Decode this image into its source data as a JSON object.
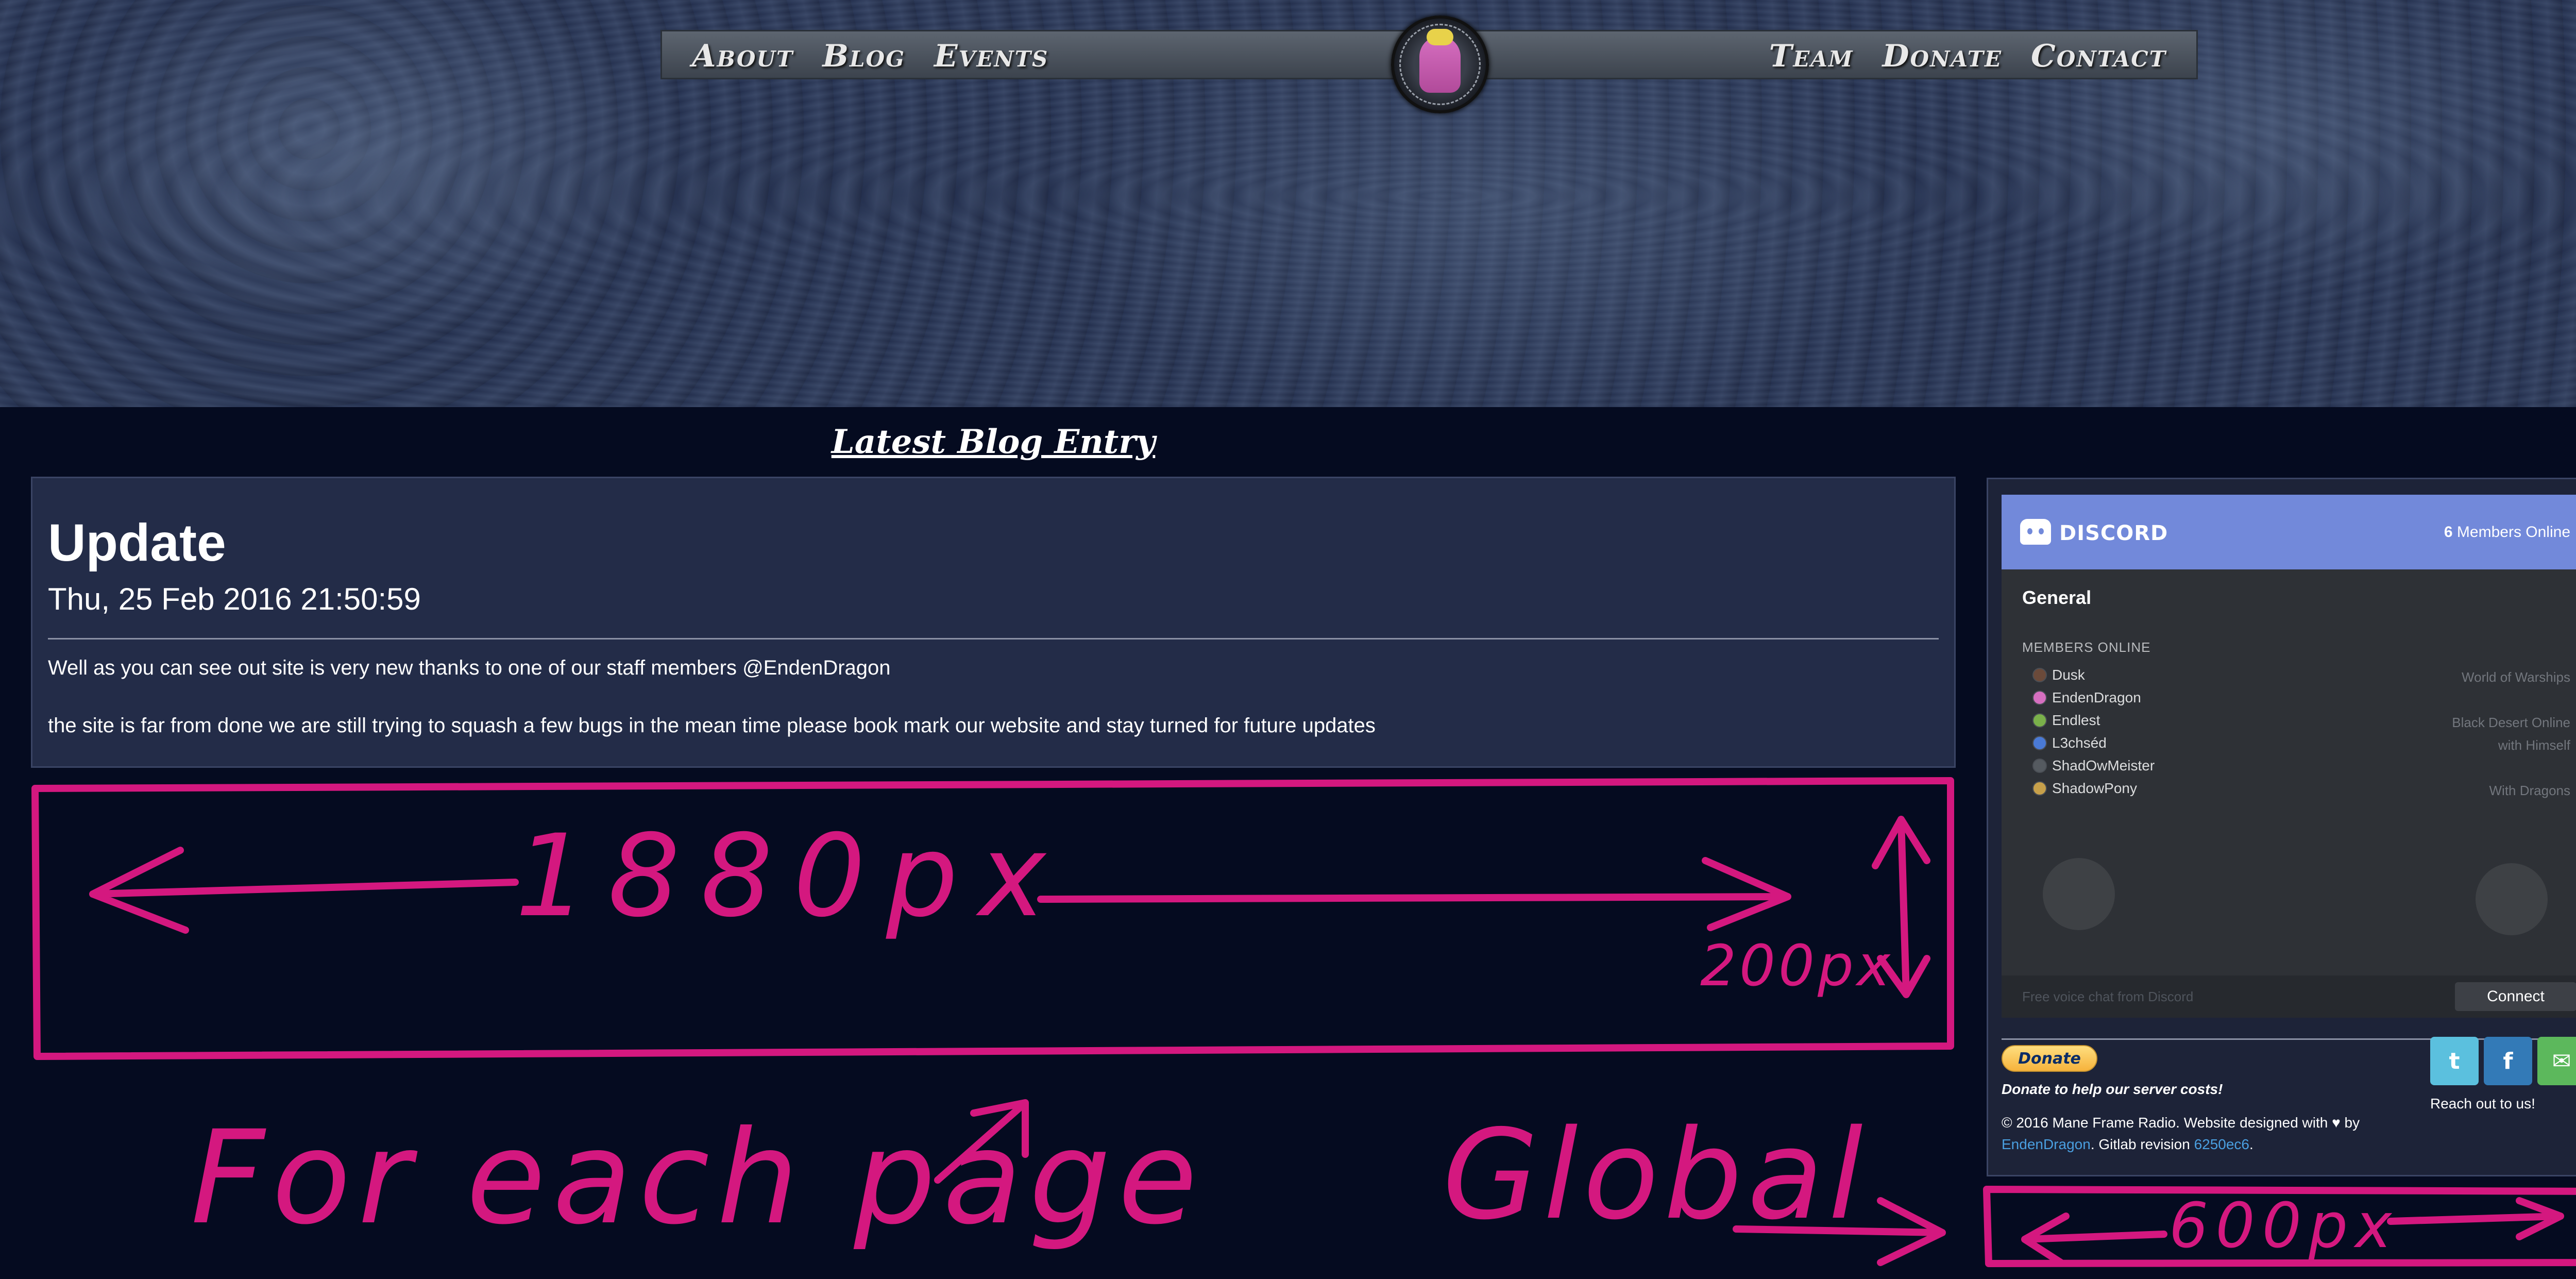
{
  "nav": {
    "left": [
      "About",
      "Blog",
      "Events"
    ],
    "right": [
      "Team",
      "Donate",
      "Contact"
    ]
  },
  "section_heading": "Latest Blog Entry",
  "blog": {
    "title": "Update",
    "date": "Thu, 25 Feb 2016 21:50:59",
    "paragraphs": [
      "Well as you can see out site is very new thanks to one of our staff members @EndenDragon",
      "the site is far from done we are still trying to squash a few bugs in the mean time please book mark our website and stay turned for future updates"
    ]
  },
  "discord": {
    "wordmark": "DISCORD",
    "online_count": "6",
    "online_label": "Members Online",
    "channel": "General",
    "members_heading": "MEMBERS ONLINE",
    "members": [
      {
        "name": "Dusk",
        "game": "World of Warships",
        "avatar_color": "#6b4a3a"
      },
      {
        "name": "EndenDragon",
        "game": "",
        "avatar_color": "#d66fc0"
      },
      {
        "name": "Endlest",
        "game": "Black Desert Online",
        "avatar_color": "#7ab04a"
      },
      {
        "name": "L3chséd",
        "game": "with Himself",
        "avatar_color": "#4a7ad6"
      },
      {
        "name": "ShadOwMeister",
        "game": "",
        "avatar_color": "#555a60"
      },
      {
        "name": "ShadowPony",
        "game": "With Dragons",
        "avatar_color": "#c7a04a"
      }
    ],
    "footer_note": "Free voice chat from Discord",
    "connect_label": "Connect",
    "header_color": "#7289da"
  },
  "donate": {
    "button_label": "Donate",
    "caption": "Donate to help our server costs!"
  },
  "social": {
    "twitter_glyph": "t",
    "facebook_glyph": "f",
    "email_glyph": "✉",
    "reach_out": "Reach out to us!"
  },
  "copyright": {
    "prefix": "© 2016 Mane Frame Radio. Website designed with",
    "heart": "♥",
    "by": "by",
    "author": "EndenDragon",
    "gitlab": ". Gitlab revision",
    "revision": "6250ec6",
    "end": "."
  },
  "annotations": {
    "width_label": "1880px",
    "height_label": "200px",
    "per_page_label": "For each page",
    "global_label": "Global",
    "sidebar_width_label": "600px",
    "color": "#d4187f"
  },
  "music_icon": "music-note-icon"
}
